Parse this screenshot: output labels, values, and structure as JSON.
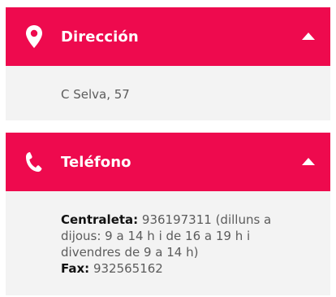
{
  "address": {
    "title": "Dirección",
    "value": "C Selva, 57",
    "icon": "map-pin-icon",
    "collapse_icon": "chevron-up-icon"
  },
  "phone": {
    "title": "Teléfono",
    "icon": "phone-icon",
    "collapse_icon": "chevron-up-icon",
    "centraleta_label": "Centraleta:",
    "centraleta_value": " 936197311 (dilluns a dijous: 9 a 14 h i de 16 a 19 h i divendres de 9 a 14 h)",
    "fax_label": "Fax:",
    "fax_value": " 932565162"
  },
  "colors": {
    "accent": "#ee0a4e",
    "panel_bg": "#f3f3f3",
    "text": "#5c5c5c"
  }
}
